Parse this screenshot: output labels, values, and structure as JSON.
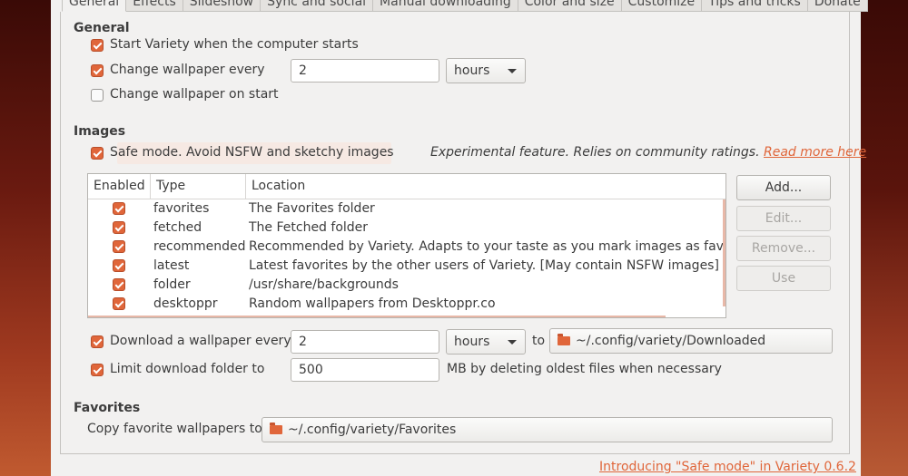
{
  "tabs": [
    "General",
    "Effects",
    "Slideshow",
    "Sync and social",
    "Manual downloading",
    "Color and size",
    "Customize",
    "Tips and tricks",
    "Donate"
  ],
  "general": {
    "title": "General",
    "start_on_boot": {
      "label": "Start Variety when the computer starts",
      "checked": true
    },
    "change_every": {
      "label": "Change wallpaper every",
      "checked": true,
      "value": "2",
      "unit": "hours"
    },
    "change_on_start": {
      "label": "Change wallpaper on start",
      "checked": false
    }
  },
  "images": {
    "title": "Images",
    "safe_mode": {
      "label": "Safe mode. Avoid NSFW and sketchy images",
      "checked": true
    },
    "experimental_note": "Experimental feature. Relies on community ratings.",
    "read_more": "Read more here",
    "columns": [
      "Enabled",
      "Type",
      "Location"
    ],
    "rows": [
      {
        "enabled": true,
        "type": "favorites",
        "location": "The Favorites folder"
      },
      {
        "enabled": true,
        "type": "fetched",
        "location": "The Fetched folder"
      },
      {
        "enabled": true,
        "type": "recommended",
        "location": "Recommended by Variety. Adapts to your taste as you mark images as favorit"
      },
      {
        "enabled": true,
        "type": "latest",
        "location": "Latest favorites by the other users of Variety. [May contain NSFW images]"
      },
      {
        "enabled": true,
        "type": "folder",
        "location": "/usr/share/backgrounds"
      },
      {
        "enabled": true,
        "type": "desktoppr",
        "location": "Random wallpapers from Desktoppr.co"
      }
    ],
    "buttons": {
      "add": "Add...",
      "edit": "Edit...",
      "remove": "Remove...",
      "use": "Use"
    }
  },
  "download": {
    "label": "Download a wallpaper every",
    "checked": true,
    "value": "2",
    "unit": "hours",
    "to_label": "to",
    "folder": "~/.config/variety/Downloaded"
  },
  "limit": {
    "label": "Limit download folder to",
    "checked": true,
    "value": "500",
    "suffix": "MB by deleting oldest files when necessary"
  },
  "favorites": {
    "title": "Favorites",
    "copy_label": "Copy favorite wallpapers to",
    "folder": "~/.config/variety/Favorites"
  },
  "footer_link": "Introducing \"Safe mode\" in Variety 0.6.2",
  "colors": {
    "accent": "#e0663a",
    "window_bg": "#f2f1f0"
  }
}
